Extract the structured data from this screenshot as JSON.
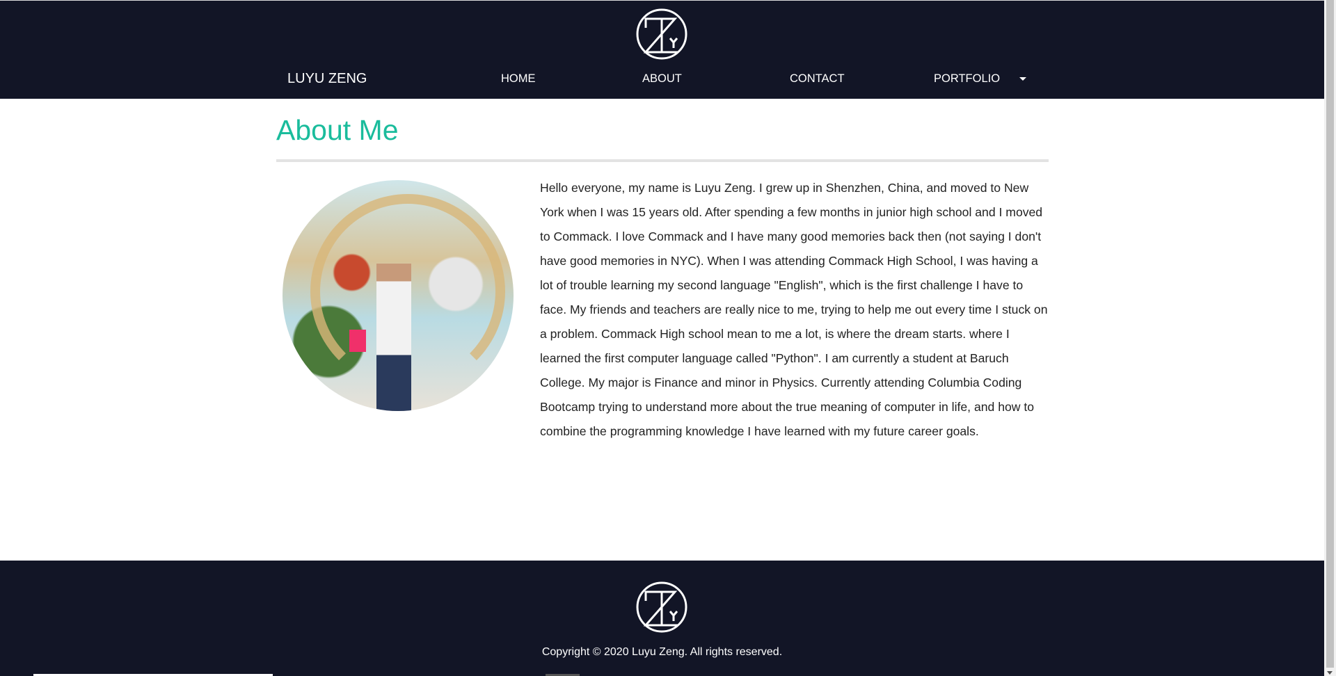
{
  "header": {
    "brand": "LUYU ZENG",
    "nav": [
      {
        "label": "HOME"
      },
      {
        "label": "ABOUT"
      },
      {
        "label": "CONTACT"
      },
      {
        "label": "PORTFOLIO"
      }
    ],
    "logo_text": "ZY"
  },
  "main": {
    "title": "About Me",
    "bio": "Hello everyone, my name is Luyu Zeng. I grew up in Shenzhen, China, and moved to New York when I was 15 years old. After spending a few months in junior high school and I moved to Commack. I love Commack and I have many good memories back then (not saying I don't have good memories in NYC). When I was attending Commack High School, I was having a lot of trouble learning my second language \"English\", which is the first challenge I have to face. My friends and teachers are really nice to me, trying to help me out every time I stuck on a problem. Commack High school mean to me a lot, is where the dream starts. where I learned the first computer language called \"Python\". I am currently a student at Baruch College. My major is Finance and minor in Physics. Currently attending Columbia Coding Bootcamp trying to understand more about the true meaning of computer in life, and how to combine the programming knowledge I have learned with my future career goals."
  },
  "footer": {
    "copyright": "Copyright © 2020 Luyu Zeng. All rights reserved."
  },
  "colors": {
    "header_bg": "#121526",
    "accent": "#1abc9c"
  }
}
